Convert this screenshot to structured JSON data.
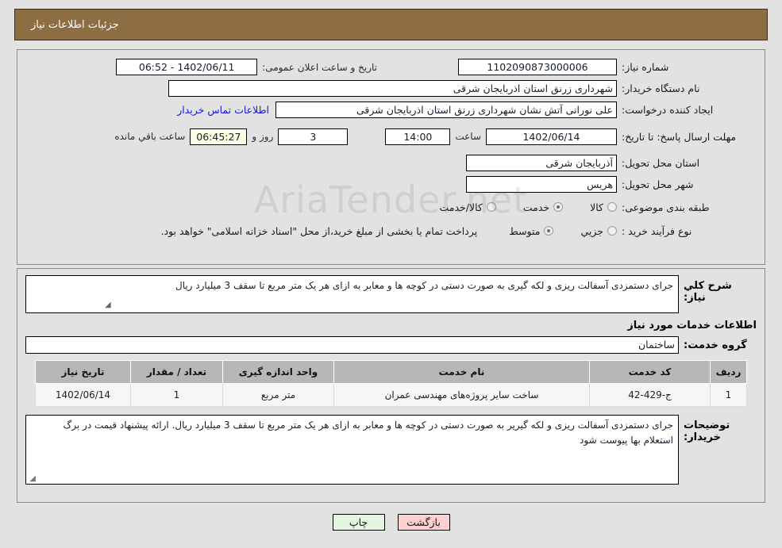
{
  "header": {
    "title": "جزئیات اطلاعات نیاز"
  },
  "colors": {
    "header_bg": "#8d6e43",
    "page_bg": "#e2e2e2",
    "link": "#1414e6",
    "table_header_bg": "#b7b7b7",
    "btn_back_bg": "#ffd0d0",
    "btn_print_bg": "#e4f5e0",
    "timer_bg": "#fdfde3"
  },
  "form": {
    "need_number_label": "شماره نیاز:",
    "need_number_value": "1102090873000006",
    "public_announce_label": "تاریخ و ساعت اعلان عمومی:",
    "public_announce_value": "1402/06/11 - 06:52",
    "buyer_org_label": "نام دستگاه خریدار:",
    "buyer_org_value": "شهرداری زرنق استان اذربایجان شرقی",
    "requester_label": "ایجاد کننده درخواست:",
    "requester_value": "علی نورانی آتش نشان شهرداری زرنق استان اذربایجان شرقی",
    "contact_link": "اطلاعات تماس خریدار",
    "deadline_label": "مهلت ارسال پاسخ: تا تاریخ:",
    "deadline_date": "1402/06/14",
    "deadline_hour_label": "ساعت",
    "deadline_hour": "14:00",
    "days_remaining": "3",
    "days_and_label": "روز و",
    "time_remaining": "06:45:27",
    "remaining_suffix": "ساعت باقي مانده",
    "delivery_province_label": "استان محل تحویل:",
    "delivery_province_value": "آذربایجان شرقی",
    "delivery_city_label": "شهر محل تحویل:",
    "delivery_city_value": "هریس",
    "category_label": "طبقه بندی موضوعی:",
    "category_options": [
      {
        "label": "کالا",
        "selected": false
      },
      {
        "label": "خدمت",
        "selected": true
      },
      {
        "label": "کالا/خدمت",
        "selected": false
      }
    ],
    "process_label": "نوع فرآیند خرید :",
    "process_options": [
      {
        "label": "جزیي",
        "selected": false
      },
      {
        "label": "متوسط",
        "selected": true
      }
    ],
    "payment_note": "پرداخت تمام یا بخشی از مبلغ خرید،از محل \"اسناد خزانه اسلامی\" خواهد بود."
  },
  "details": {
    "general_desc_label": "شرح کلي نیاز:",
    "general_desc_value": "جرای دستمزدی آسفالت ریزی و لکه گیری به صورت دستی در کوچه ها و معابر به ازای هر یک متر مربع تا سقف 3 میلیارد ریال",
    "services_heading": "اطلاعات خدمات مورد نیاز",
    "service_group_label": "گروه خدمت:",
    "service_group_value": "ساختمان",
    "buyer_notes_label": "توضیحات خریدار:",
    "buyer_notes_value": "جرای دستمزدی آسفالت ریزی و لکه گیریر به صورت دستی در کوچه ها و معابر به ازای هر یک متر مربع تا سقف 3 میلیارد ریال. ارائه پیشنهاد قیمت در برگ استعلام بها پیوست شود"
  },
  "table": {
    "columns": [
      "ردیف",
      "کد خدمت",
      "نام خدمت",
      "واحد اندازه گیری",
      "تعداد / مقدار",
      "تاریخ نیاز"
    ],
    "rows": [
      {
        "row_no": "1",
        "service_code": "ج-429-42",
        "service_name": "ساخت سایر پروژه‌های مهندسی عمران",
        "unit": "متر مربع",
        "quantity": "1",
        "need_date": "1402/06/14"
      }
    ]
  },
  "footer": {
    "back_label": "بازگشت",
    "print_label": "چاپ"
  },
  "watermark": {
    "text": "AriaTender.net"
  }
}
